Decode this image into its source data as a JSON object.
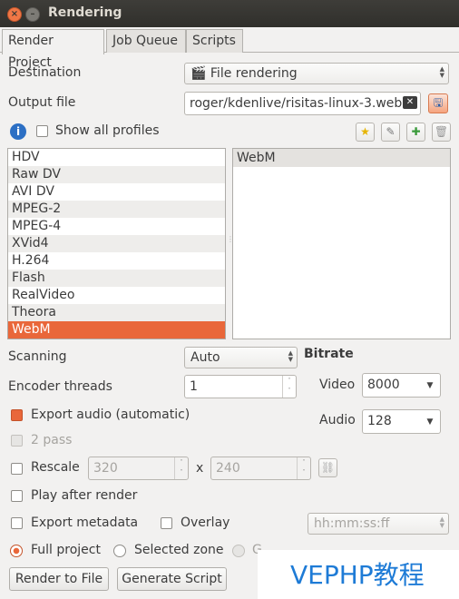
{
  "window": {
    "title": "Rendering"
  },
  "tabs": [
    {
      "label": "Render Project"
    },
    {
      "label": "Job Queue"
    },
    {
      "label": "Scripts"
    }
  ],
  "destination": {
    "label": "Destination",
    "value": "File rendering",
    "icon": "film-icon"
  },
  "output": {
    "label": "Output file",
    "value": "roger/kdenlive/risitas-linux-3.webm"
  },
  "profiles": {
    "show_all_label": "Show all profiles",
    "show_all_checked": false,
    "formats": [
      "HDV",
      "Raw DV",
      "AVI DV",
      "MPEG-2",
      "MPEG-4",
      "XVid4",
      "H.264",
      "Flash",
      "RealVideo",
      "Theora",
      "WebM"
    ],
    "selected_format": "WebM",
    "profile_list": [
      "WebM"
    ]
  },
  "scanning": {
    "label": "Scanning",
    "value": "Auto"
  },
  "encoder_threads": {
    "label": "Encoder threads",
    "value": "1"
  },
  "bitrate": {
    "title": "Bitrate",
    "video_label": "Video",
    "video_value": "8000",
    "audio_label": "Audio",
    "audio_value": "128"
  },
  "export_audio": {
    "label": "Export audio (automatic)",
    "checked": true
  },
  "two_pass": {
    "label": "2 pass",
    "checked": false,
    "enabled": false
  },
  "rescale": {
    "label": "Rescale",
    "width": "320",
    "x": "x",
    "height": "240"
  },
  "play_after": {
    "label": "Play after render"
  },
  "export_metadata": {
    "label": "Export metadata"
  },
  "overlay": {
    "label": "Overlay",
    "format_placeholder": "hh:mm:ss:ff"
  },
  "range": {
    "full_label": "Full project",
    "selected_label": "Selected zone",
    "third_label": "G"
  },
  "buttons": {
    "render": "Render to File",
    "script": "Generate Script"
  },
  "watermark": "VEPHP教程",
  "colors": {
    "accent": "#e9673a",
    "titlebar": "#3c3b37",
    "watermark": "#1e7bd6"
  }
}
